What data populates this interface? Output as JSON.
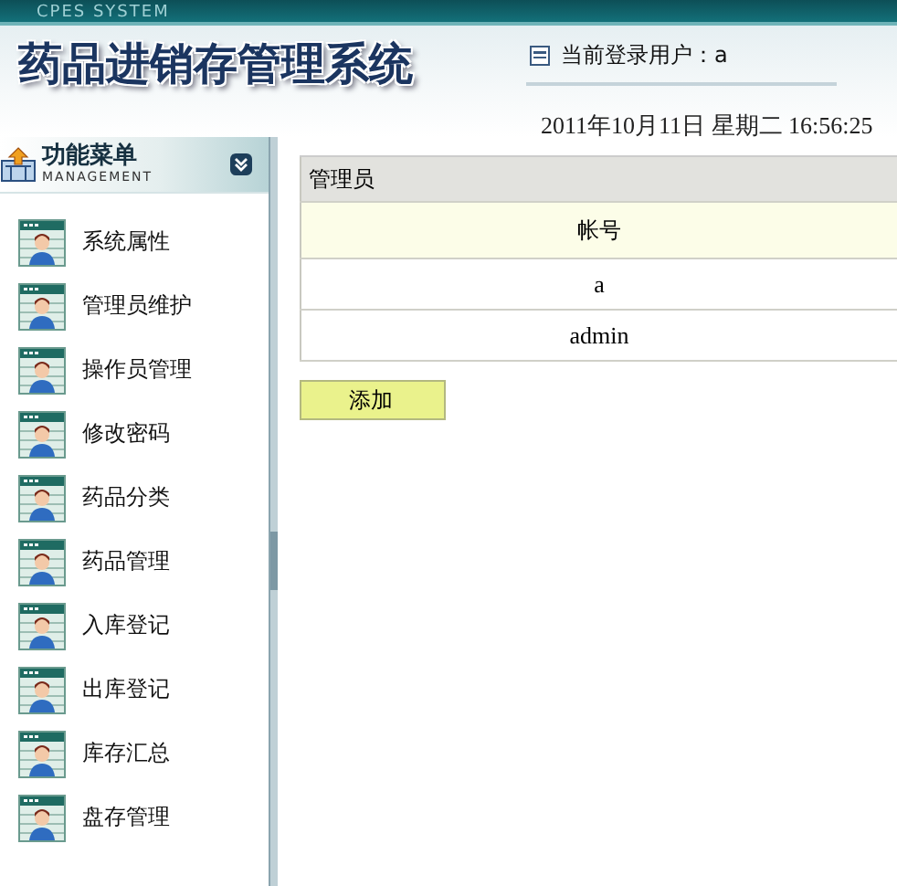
{
  "top_bar": {
    "caption": "CPES SYSTEM"
  },
  "header": {
    "title": "药品进销存管理系统",
    "user_label": "当前登录用户：a",
    "datetime": "2011年10月11日  星期二  16:56:25"
  },
  "sidebar": {
    "title": "功能菜单",
    "subtitle": "MANAGEMENT",
    "expanded": true,
    "items": [
      {
        "label": "系统属性"
      },
      {
        "label": "管理员维护"
      },
      {
        "label": "操作员管理"
      },
      {
        "label": "修改密码"
      },
      {
        "label": "药品分类"
      },
      {
        "label": "药品管理"
      },
      {
        "label": "入库登记"
      },
      {
        "label": "出库登记"
      },
      {
        "label": "库存汇总"
      },
      {
        "label": "盘存管理"
      }
    ]
  },
  "panel": {
    "title": "管理员",
    "columns": [
      "帐号"
    ],
    "rows": [
      [
        "a"
      ],
      [
        "admin"
      ]
    ],
    "buttons": [
      "添加"
    ]
  }
}
